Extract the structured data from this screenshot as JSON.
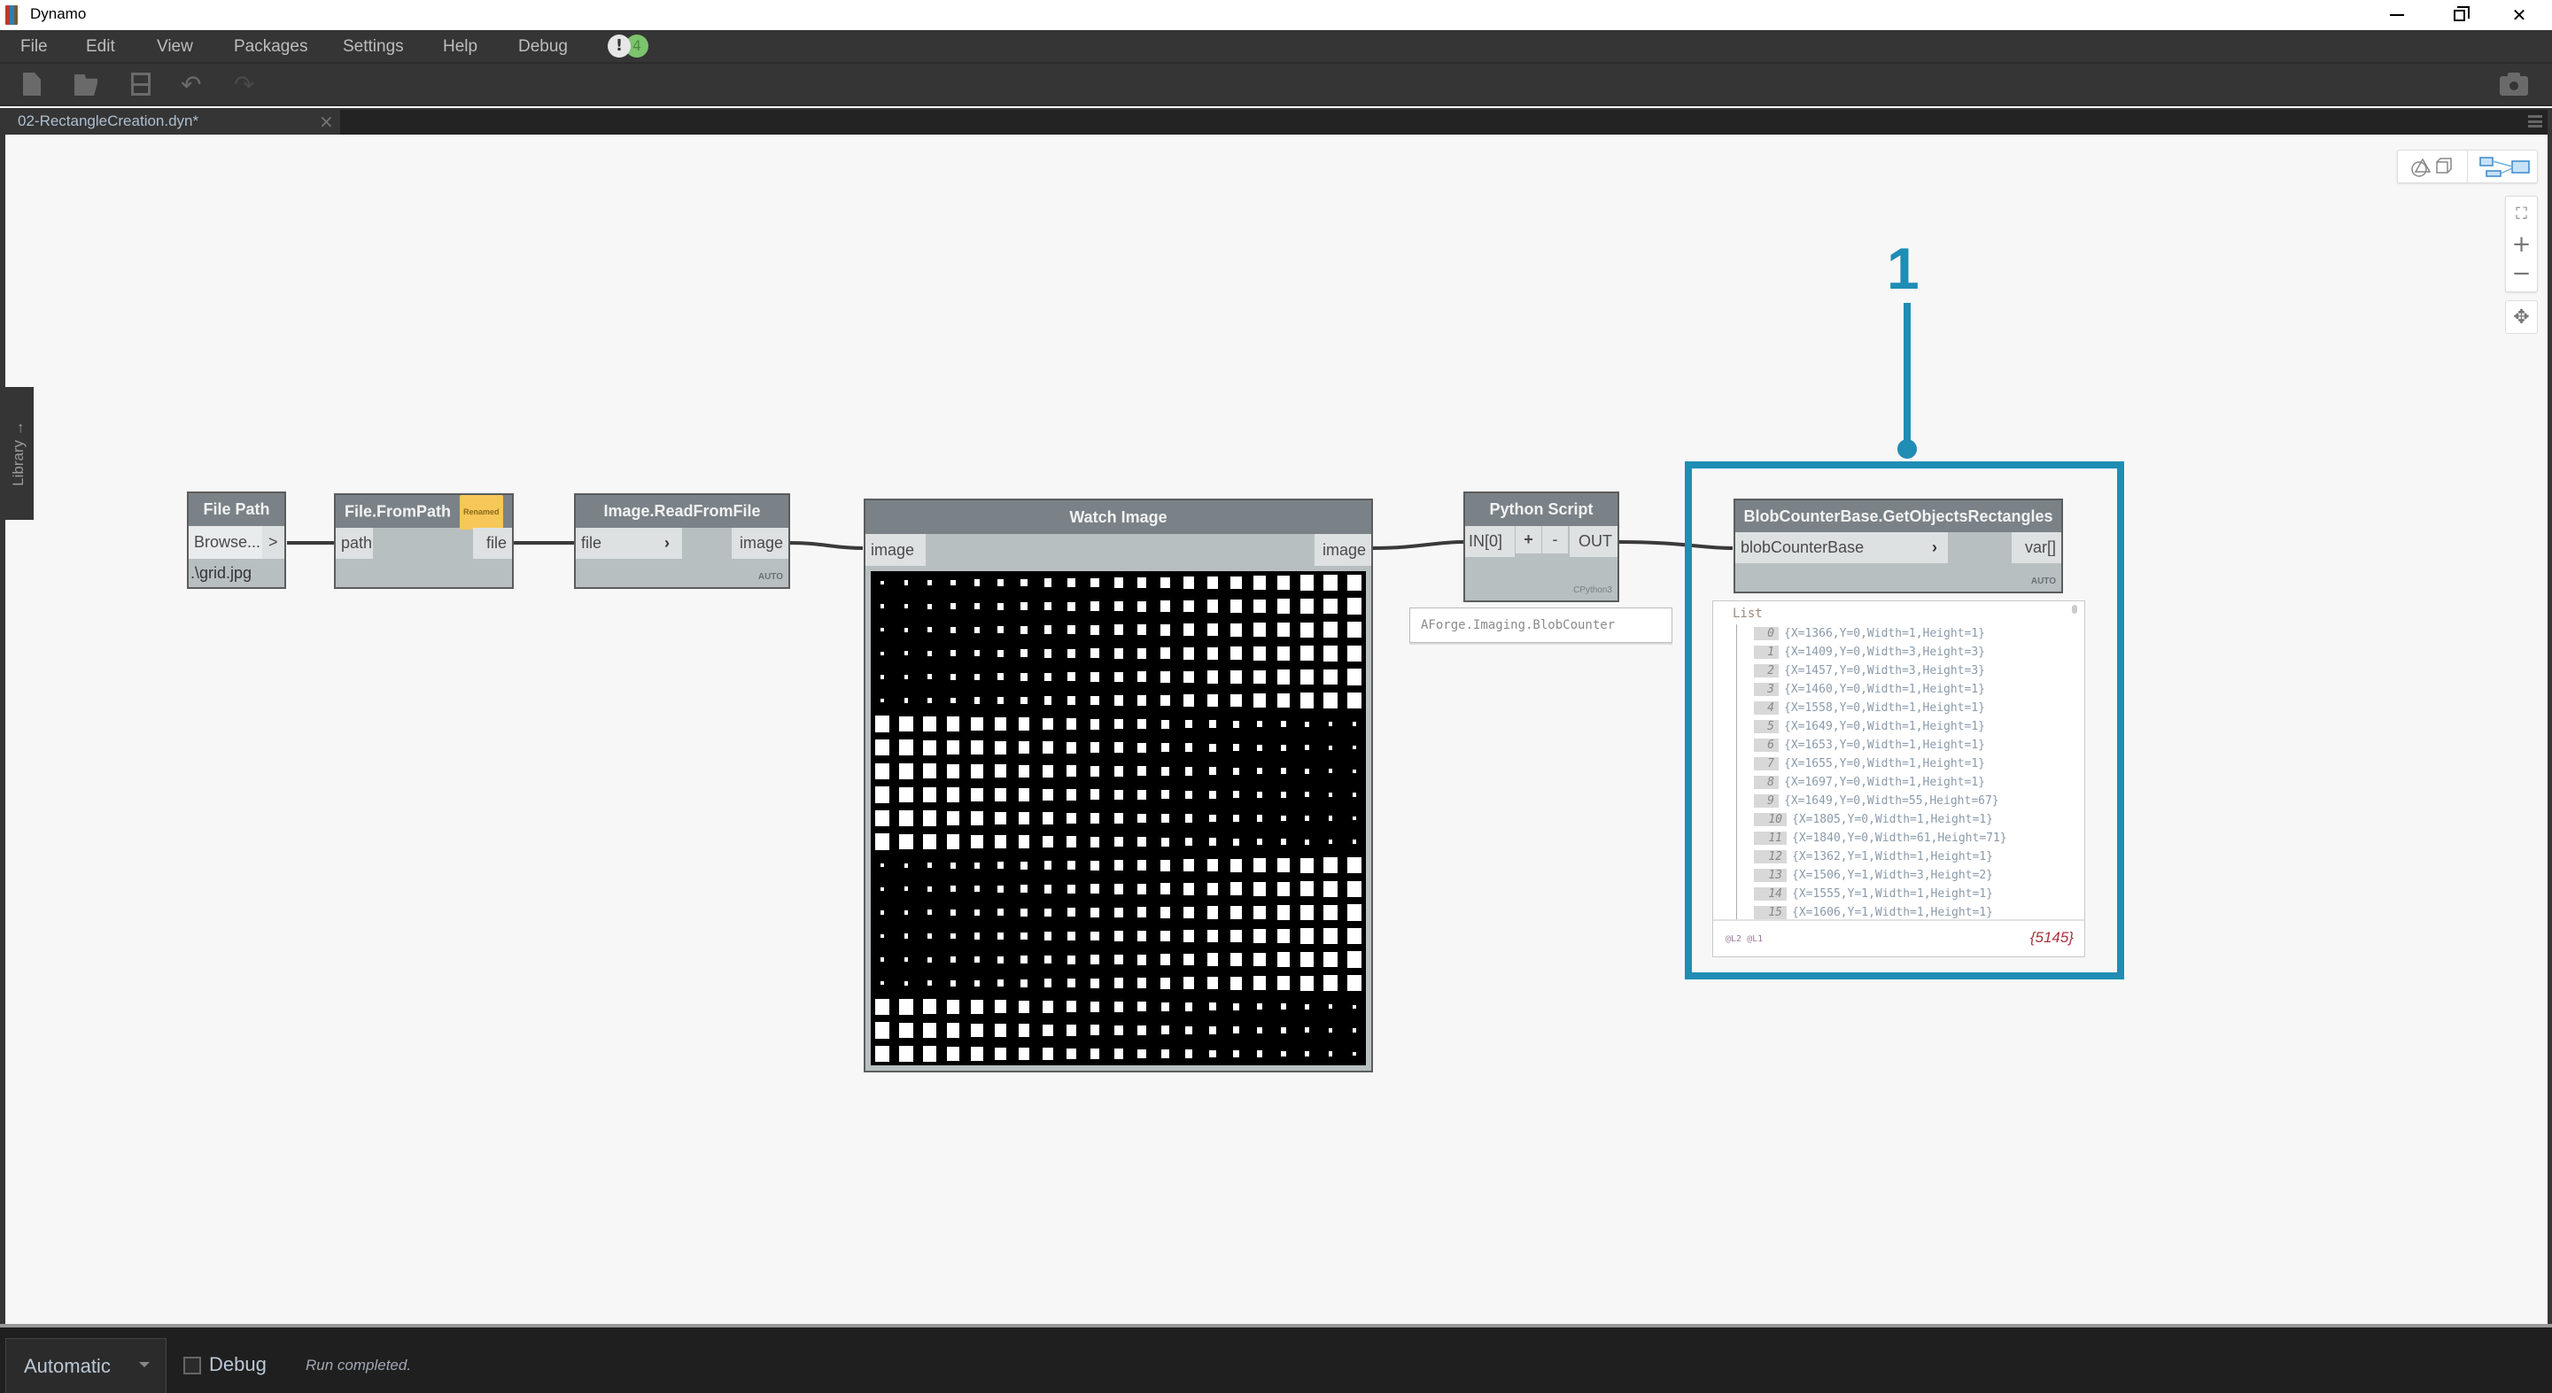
{
  "window": {
    "title": "Dynamo",
    "controls": {
      "minimize": "minimize",
      "maximize": "restore",
      "close": "close"
    }
  },
  "menu": {
    "items": [
      {
        "label": "File"
      },
      {
        "label": "Edit"
      },
      {
        "label": "View"
      },
      {
        "label": "Packages"
      },
      {
        "label": "Settings"
      },
      {
        "label": "Help"
      },
      {
        "label": "Debug"
      }
    ],
    "notifications": {
      "warning_glyph": "!",
      "ok_glyph": "4"
    }
  },
  "toolbar": {
    "buttons": [
      "new-file-icon",
      "open-file-icon",
      "save-icon",
      "undo-icon",
      "redo-icon"
    ],
    "undo_glyph": "↶",
    "redo_glyph": "↷",
    "camera": "camera-icon"
  },
  "tabs": [
    {
      "label": "02-RectangleCreation.dyn*",
      "close": "×",
      "active": true
    }
  ],
  "library": {
    "label": "Library →"
  },
  "canvas_controls": {
    "fit": "⛶",
    "zoom_in": "+",
    "zoom_out": "−",
    "pan": "✥"
  },
  "nodes": {
    "file_path": {
      "title": "File Path",
      "browse_label": "Browse...",
      "browse_arrow": ">",
      "value": ".\\grid.jpg"
    },
    "file_from_path": {
      "title": "File.FromPath",
      "badge": "Renamed",
      "input": "path",
      "output": "file"
    },
    "image_read": {
      "title": "Image.ReadFromFile",
      "input": "file",
      "input_arrow": "›",
      "output": "image",
      "lacing": "AUTO"
    },
    "watch_image": {
      "title": "Watch Image",
      "input": "image",
      "output": "image",
      "grid": {
        "columns": 21,
        "rows": 21,
        "block_rows": 6,
        "pattern": "alternating small-to-large / large-to-small bands"
      }
    },
    "python_script": {
      "title": "Python Script",
      "input": "IN[0]",
      "add": "+",
      "remove": "-",
      "output": "OUT",
      "engine": "CPython3",
      "preview": "AForge.Imaging.BlobCounter"
    },
    "blob_rects": {
      "title": "BlobCounterBase.GetObjectsRectangles",
      "input": "blobCounterBase",
      "input_arrow": "›",
      "output": "var[]",
      "lacing": "AUTO",
      "preview": {
        "header": "List",
        "items": [
          {
            "index": "0",
            "value": "{X=1366,Y=0,Width=1,Height=1}"
          },
          {
            "index": "1",
            "value": "{X=1409,Y=0,Width=3,Height=3}"
          },
          {
            "index": "2",
            "value": "{X=1457,Y=0,Width=3,Height=3}"
          },
          {
            "index": "3",
            "value": "{X=1460,Y=0,Width=1,Height=1}"
          },
          {
            "index": "4",
            "value": "{X=1558,Y=0,Width=1,Height=1}"
          },
          {
            "index": "5",
            "value": "{X=1649,Y=0,Width=1,Height=1}"
          },
          {
            "index": "6",
            "value": "{X=1653,Y=0,Width=1,Height=1}"
          },
          {
            "index": "7",
            "value": "{X=1655,Y=0,Width=1,Height=1}"
          },
          {
            "index": "8",
            "value": "{X=1697,Y=0,Width=1,Height=1}"
          },
          {
            "index": "9",
            "value": "{X=1649,Y=0,Width=55,Height=67}"
          },
          {
            "index": "10",
            "value": "{X=1805,Y=0,Width=1,Height=1}"
          },
          {
            "index": "11",
            "value": "{X=1840,Y=0,Width=61,Height=71}"
          },
          {
            "index": "12",
            "value": "{X=1362,Y=1,Width=1,Height=1}"
          },
          {
            "index": "13",
            "value": "{X=1506,Y=1,Width=3,Height=2}"
          },
          {
            "index": "14",
            "value": "{X=1555,Y=1,Width=1,Height=1}"
          },
          {
            "index": "15",
            "value": "{X=1606,Y=1,Width=1,Height=1}"
          }
        ],
        "levels": "@L2 @L1",
        "count": "{5145}"
      }
    }
  },
  "annotation": {
    "number": "1",
    "color": "#1f8db4"
  },
  "statusbar": {
    "run_mode": "Automatic",
    "debug_label": "Debug",
    "debug_checked": false,
    "status": "Run completed."
  }
}
